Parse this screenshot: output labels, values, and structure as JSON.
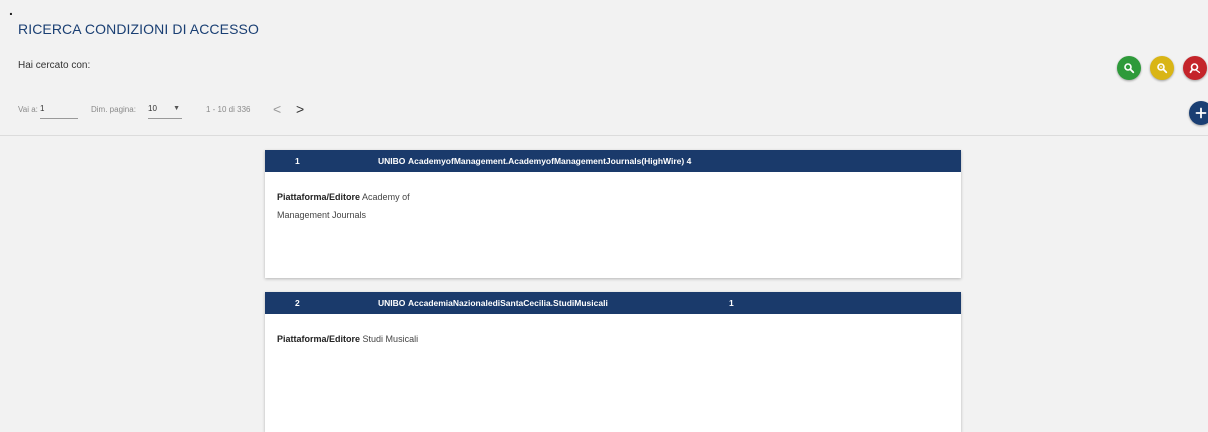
{
  "header": {
    "marker": ".",
    "title": "RICERCA CONDIZIONI DI ACCESSO",
    "search_label": "Hai cercato con:"
  },
  "actions": {
    "search_icon": "search-icon",
    "refine_icon": "search-refine-icon",
    "clear_icon": "search-clear-icon",
    "add_icon": "plus-icon",
    "colors": {
      "green": "#2e9a3a",
      "yellow": "#d9b515",
      "red": "#c4242a",
      "navy": "#1a3f73"
    }
  },
  "pager": {
    "goto_label": "Vai a:",
    "goto_value": "1",
    "size_label": "Dim. pagina:",
    "size_value": "10",
    "range": "1 - 10 di 336",
    "prev": "<",
    "next": ">"
  },
  "results": [
    {
      "num": "1",
      "uni": "UNIBO",
      "name": "AcademyofManagement.AcademyofManagementJournals(HighWire) 4",
      "count": "",
      "field_label": "Piattaforma/Editore",
      "field_value_1": "Academy of",
      "field_value_2": "Management Journals"
    },
    {
      "num": "2",
      "uni": "UNIBO",
      "name": "AccademiaNazionalediSantaCecilia.StudiMusicali",
      "count": "1",
      "field_label": "Piattaforma/Editore",
      "field_value_1": "Studi Musicali"
    }
  ]
}
